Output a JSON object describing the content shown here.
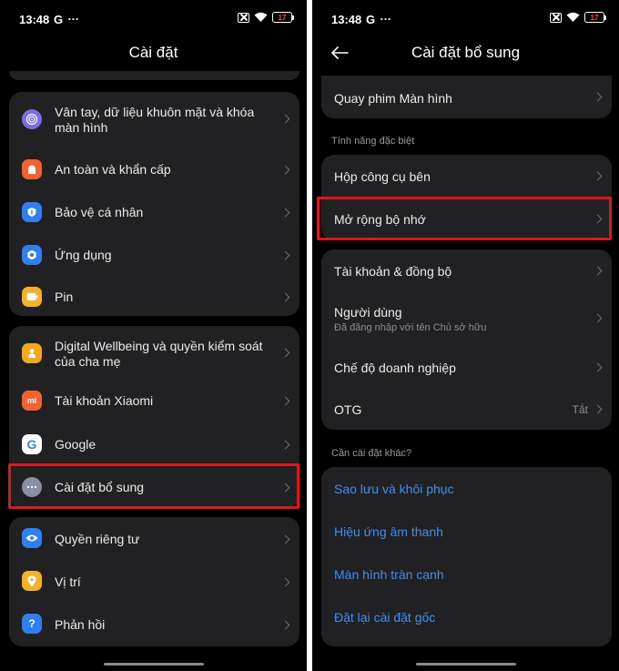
{
  "status_bar": {
    "time": "13:48",
    "g": "G",
    "dots": "…",
    "battery": "17"
  },
  "left": {
    "title": "Cài đặt",
    "group1": [
      {
        "label": "Vân tay, dữ liệu khuôn mặt và khóa màn hình",
        "icon": "fingerprint-icon",
        "color": "#7b6de8"
      },
      {
        "label": "An toàn và khẩn cấp",
        "icon": "emergency-icon",
        "color": "#f0622f"
      },
      {
        "label": "Bảo vệ cá nhân",
        "icon": "privacy-shield-icon",
        "color": "#2f7ff0"
      },
      {
        "label": "Ứng dụng",
        "icon": "apps-icon",
        "color": "#2f7ff0"
      },
      {
        "label": "Pin",
        "icon": "battery-icon",
        "color": "#f4b22a"
      }
    ],
    "group2": [
      {
        "label": "Digital Wellbeing và quyền kiểm soát của cha mẹ",
        "icon": "wellbeing-icon",
        "color": "#f2a81e"
      },
      {
        "label": "Tài khoản Xiaomi",
        "icon": "xiaomi-icon",
        "color": "#f0622f",
        "glyph": "mi"
      },
      {
        "label": "Google",
        "icon": "google-icon",
        "color": "#ffffff",
        "glyph": "G"
      },
      {
        "label": "Cài đặt bổ sung",
        "icon": "more-settings-icon",
        "color": "#8a8fa3"
      }
    ],
    "group3": [
      {
        "label": "Quyền riêng tư",
        "icon": "eye-icon",
        "color": "#2f7ff0"
      },
      {
        "label": "Vị trí",
        "icon": "location-icon",
        "color": "#f4b22a"
      },
      {
        "label": "Phản hồi",
        "icon": "feedback-icon",
        "color": "#2f7ff0",
        "glyph": "?"
      }
    ]
  },
  "right": {
    "title": "Cài đặt bổ sung",
    "top_item": "Quay phim Màn hình",
    "section_special": "Tính năng đặc biệt",
    "special": [
      "Hộp công cụ bên",
      "Mở rộng bộ nhớ"
    ],
    "account": {
      "sync": "Tài khoản & đồng bộ",
      "users": "Người dùng",
      "users_sub": "Đã đăng nhập với tên Chủ sở hữu",
      "enterprise": "Chế độ doanh nghiệp",
      "otg": "OTG",
      "otg_value": "Tắt"
    },
    "section_other": "Cần cài đặt khác?",
    "links": [
      "Sao lưu và khôi phục",
      "Hiệu ứng âm thanh",
      "Màn hình tràn cạnh",
      "Đặt lại cài đặt gốc"
    ]
  }
}
